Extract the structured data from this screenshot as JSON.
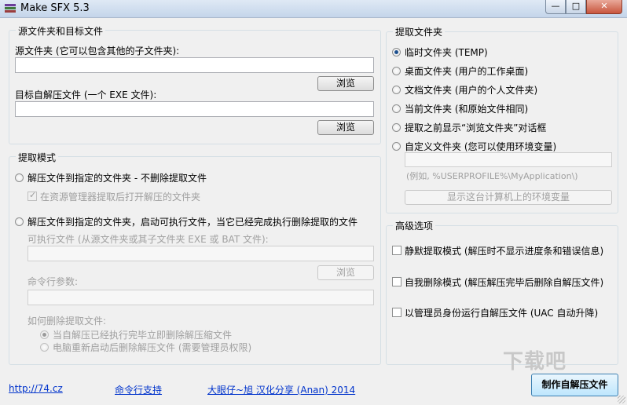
{
  "window": {
    "title": "Make SFX 5.3",
    "minimize": "—",
    "maximize": "□",
    "close": "✕"
  },
  "source": {
    "legend": "源文件夹和目标文件",
    "source_label": "源文件夹 (它可以包含其他的子文件夹):",
    "source_value": "",
    "browse1": "浏览",
    "target_label": "目标自解压文件 (一个 EXE 文件):",
    "target_value": "",
    "browse2": "浏览"
  },
  "extract_to": {
    "legend": "提取文件夹",
    "options": [
      "临时文件夹 (TEMP)",
      "桌面文件夹 (用户的工作桌面)",
      "文档文件夹 (用户的个人文件夹)",
      "当前文件夹 (和原始文件相同)",
      "提取之前显示“浏览文件夹”对话框",
      "自定义文件夹 (您可以使用环境变量)"
    ],
    "selected_index": 0,
    "custom_value": "",
    "example": "(例如, %USERPROFILE%\\MyApplication\\)",
    "env_button": "显示这台计算机上的环境变量"
  },
  "mode": {
    "legend": "提取模式",
    "option1": "解压文件到指定的文件夹 - 不删除提取文件",
    "open_in_explorer": "在资源管理器提取后打开解压的文件夹",
    "option2": "解压文件到指定的文件夹，启动可执行文件，当它已经完成执行删除提取的文件",
    "exe_label": "可执行文件 (从源文件夹或其子文件夹 EXE 或 BAT 文件):",
    "exe_value": "",
    "browse3": "浏览",
    "cmd_label": "命令行参数:",
    "cmd_value": "",
    "delete_label": "如何删除提取文件:",
    "delete_opt1": "当自解压已经执行完毕立即删除解压缩文件",
    "delete_opt2": "电脑重新启动后删除解压文件 (需要管理员权限)"
  },
  "advanced": {
    "legend": "高级选项",
    "opt1": "静默提取模式 (解压时不显示进度条和错误信息)",
    "opt2": "自我删除模式 (解压解压完毕后删除自解压文件)",
    "opt3": "以管理员身份运行自解压文件 (UAC 自动升降)"
  },
  "footer": {
    "link1": "http://74.cz",
    "link2": "命令行支持",
    "link3": "大眼仔~旭 汉化分享 (Anan) 2014",
    "make_button": "制作自解压文件"
  },
  "watermark": "下载吧"
}
